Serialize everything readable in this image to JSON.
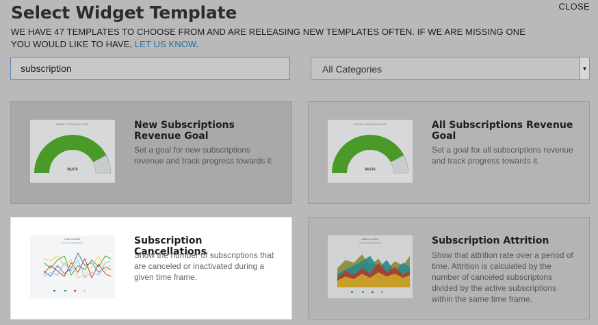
{
  "header": {
    "title": "Select Widget Template",
    "close_label": "CLOSE",
    "intro_text": "WE HAVE 47 TEMPLATES TO CHOOSE FROM AND ARE RELEASING NEW TEMPLATES OFTEN. IF WE ARE MISSING ONE YOU WOULD LIKE TO HAVE,",
    "intro_link": "LET US KNOW",
    "intro_end": "."
  },
  "filters": {
    "search_value": "subscription",
    "category_value": "All Categories"
  },
  "templates": [
    {
      "title": "New Subscriptions Revenue Goal",
      "description": "Set a goal for new subscriptions revenue and track progress towards it",
      "thumb_title": "WEEKLY REVENUE GOAL",
      "thumb_value": "$8,676"
    },
    {
      "title": "All Subscriptions Revenue Goal",
      "description": "Set a goal for all subscriptions revenue and track progress towards it.",
      "thumb_title": "WEEKLY REVENUE GOAL",
      "thumb_value": "$8,676"
    },
    {
      "title": "Subscription Cancellations",
      "description": "Show the number of subscriptions that are canceled or inactivated during a given time frame.",
      "thumb_title": "LINE CHART",
      "thumb_subtitle": "SOURCE: MICROMARKET"
    },
    {
      "title": "Subscription Attrition",
      "description": "Show that attrition rate over a period of time. Attrition is calculated by the number of canceled subscriptons divided by the active subscriptions within the same time frame.",
      "thumb_title": "AREA CHART",
      "thumb_subtitle": "SOURCE: MICROMARKET"
    }
  ],
  "colors": {
    "gauge_green": "#4a9a2a",
    "link_blue": "#1c6fa8"
  }
}
